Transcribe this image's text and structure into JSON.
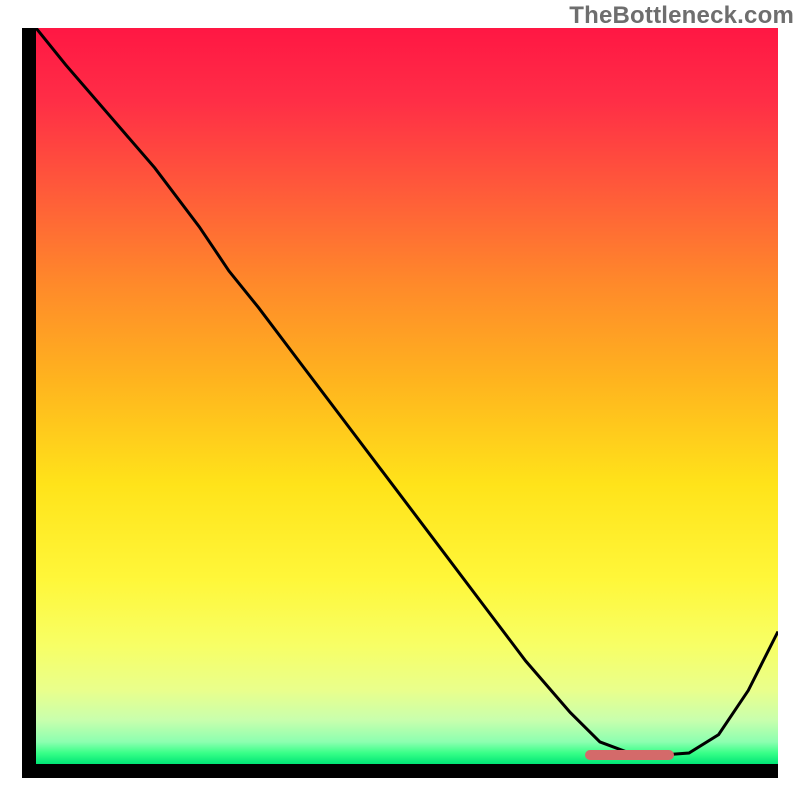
{
  "watermark": "TheBottleneck.com",
  "colors": {
    "curve_stroke": "#000000",
    "marker": "#d46a6a",
    "gradient_stops": [
      {
        "at": 0.0,
        "color": "#ff1744"
      },
      {
        "at": 0.1,
        "color": "#ff2e46"
      },
      {
        "at": 0.22,
        "color": "#ff5a3a"
      },
      {
        "at": 0.35,
        "color": "#ff8a2a"
      },
      {
        "at": 0.48,
        "color": "#ffb41e"
      },
      {
        "at": 0.62,
        "color": "#ffe31a"
      },
      {
        "at": 0.75,
        "color": "#fff73a"
      },
      {
        "at": 0.84,
        "color": "#f7ff66"
      },
      {
        "at": 0.9,
        "color": "#e9ff8c"
      },
      {
        "at": 0.94,
        "color": "#c9ffad"
      },
      {
        "at": 0.97,
        "color": "#8cffb0"
      },
      {
        "at": 0.985,
        "color": "#39ff88"
      },
      {
        "at": 1.0,
        "color": "#00e676"
      }
    ]
  },
  "chart_data": {
    "type": "line",
    "title": "",
    "xlabel": "",
    "ylabel": "",
    "xlim": [
      0,
      100
    ],
    "ylim": [
      0,
      100
    ],
    "grid": false,
    "legend": false,
    "series": [
      {
        "name": "bottleneck-curve",
        "x": [
          0,
          4,
          10,
          16,
          22,
          24,
          26,
          30,
          36,
          42,
          48,
          54,
          60,
          66,
          72,
          76,
          80,
          84,
          88,
          92,
          96,
          100
        ],
        "y": [
          100,
          95,
          88,
          81,
          73,
          70,
          67,
          62,
          54,
          46,
          38,
          30,
          22,
          14,
          7,
          3,
          1.5,
          1.2,
          1.5,
          4,
          10,
          18
        ]
      }
    ],
    "annotations": [
      {
        "name": "optimal-range-marker",
        "type": "hbar",
        "y": 1.2,
        "x0": 74,
        "x1": 86
      }
    ]
  }
}
